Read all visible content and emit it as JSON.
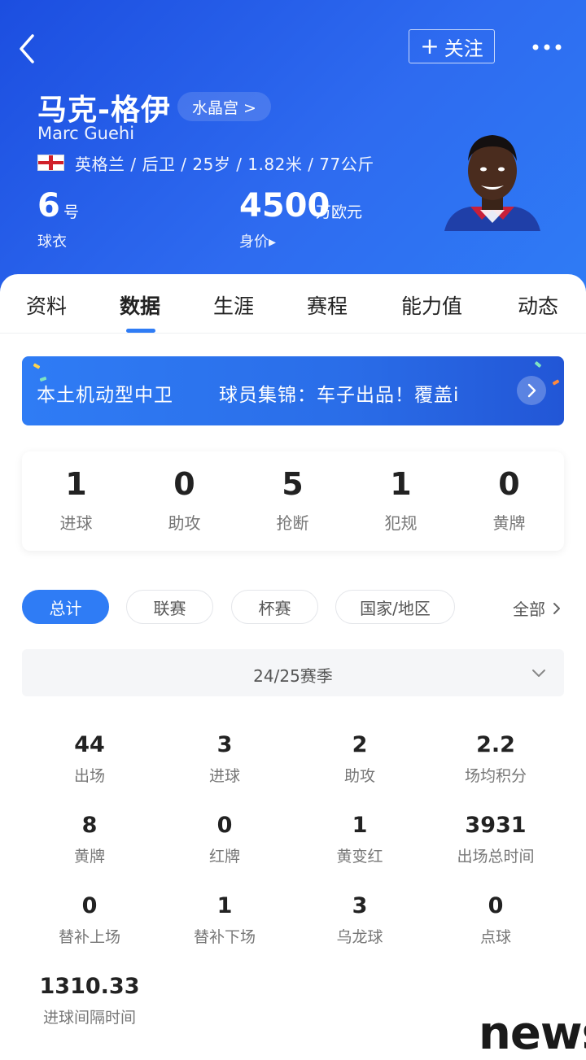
{
  "header": {
    "follow_label": "关注",
    "player_name_cn": "马克-格伊",
    "team_link": "水晶宫 >",
    "player_name_en": "Marc Guehi",
    "bio": "英格兰 / 后卫 / 25岁 / 1.82米 / 77公斤",
    "shirt_number": "6",
    "shirt_unit": "号",
    "shirt_label": "球衣",
    "market_value": "4500",
    "market_value_unit": "万欧元",
    "market_value_label": "身价▸",
    "accent_color": "#2f7cf5"
  },
  "tabs": [
    "资料",
    "数据",
    "生涯",
    "赛程",
    "能力值",
    "动态"
  ],
  "active_tab": "数据",
  "banner": {
    "text_1": "本土机动型中卫",
    "text_2": "球员集锦：车子出品！覆盖i"
  },
  "quick_stats": [
    {
      "value": "1",
      "label": "进球"
    },
    {
      "value": "0",
      "label": "助攻"
    },
    {
      "value": "5",
      "label": "抢断"
    },
    {
      "value": "1",
      "label": "犯规"
    },
    {
      "value": "0",
      "label": "黄牌"
    }
  ],
  "filters": {
    "chips": [
      "总计",
      "联赛",
      "杯赛",
      "国家/地区"
    ],
    "active": "总计",
    "all_label": "全部"
  },
  "season": "24/25赛季",
  "stats": [
    {
      "value": "44",
      "label": "出场"
    },
    {
      "value": "3",
      "label": "进球"
    },
    {
      "value": "2",
      "label": "助攻"
    },
    {
      "value": "2.2",
      "label": "场均积分"
    },
    {
      "value": "8",
      "label": "黄牌"
    },
    {
      "value": "0",
      "label": "红牌"
    },
    {
      "value": "1",
      "label": "黄变红"
    },
    {
      "value": "3931",
      "label": "出场总时间"
    },
    {
      "value": "0",
      "label": "替补上场"
    },
    {
      "value": "1",
      "label": "替补下场"
    },
    {
      "value": "3",
      "label": "乌龙球"
    },
    {
      "value": "0",
      "label": "点球"
    },
    {
      "value": "1310.33",
      "label": "进球间隔时间"
    }
  ],
  "watermark": "news"
}
